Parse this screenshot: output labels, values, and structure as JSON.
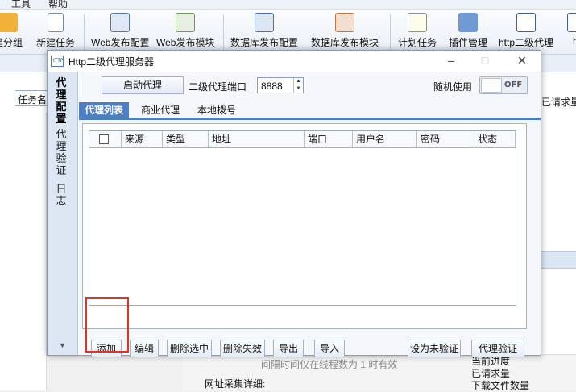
{
  "background": {
    "menubar": [
      "工具",
      "帮助"
    ],
    "toolbar": [
      {
        "label": "建分组",
        "icon": "folder-icon"
      },
      {
        "label": "新建任务",
        "icon": "new-doc-icon"
      },
      {
        "label": "Web发布配置",
        "icon": "web-config-icon"
      },
      {
        "label": "Web发布模块",
        "icon": "web-module-icon"
      },
      {
        "label": "数据库发布配置",
        "icon": "db-config-icon"
      },
      {
        "label": "数据库发布模块",
        "icon": "db-module-icon"
      },
      {
        "label": "计划任务",
        "icon": "schedule-icon"
      },
      {
        "label": "插件管理",
        "icon": "puzzle-icon"
      },
      {
        "label": "http二级代理",
        "icon": "http-icon"
      },
      {
        "label": "ht",
        "icon": "http-icon"
      }
    ],
    "task_input": "任务名",
    "right_label": "已请求量",
    "note": "间隔时间仅在线程数为 1 时有效",
    "detail_label": "网址采集详细:",
    "stats": [
      "当前进度",
      "已请求量",
      "下载文件数量"
    ]
  },
  "dialog": {
    "title": "Http二级代理服务器",
    "title_icon": "HTTP",
    "sidebar": [
      "代理配置",
      "代理验证",
      "日志"
    ],
    "start_button": "启动代理",
    "port_label": "二级代理端口",
    "port_value": "8888",
    "random_label": "随机使用",
    "toggle_text": "OFF",
    "tabs": [
      "代理列表",
      "商业代理",
      "本地拨号"
    ],
    "columns": [
      "来源",
      "类型",
      "地址",
      "端口",
      "用户名",
      "密码",
      "状态"
    ],
    "buttons": [
      "添加",
      "编辑",
      "删除选中",
      "删除失效",
      "导出",
      "导入",
      "设为未验证",
      "代理验证"
    ]
  },
  "colors": {
    "accent": "#4d7fc4",
    "highlight": "#e03523"
  }
}
